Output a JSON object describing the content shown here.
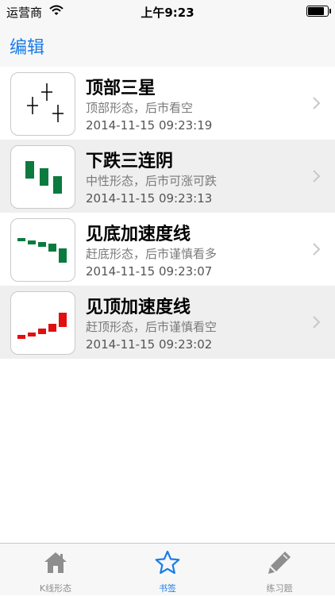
{
  "status_bar": {
    "carrier": "运营商",
    "time": "上午9:23",
    "battery_level": 0.9
  },
  "nav": {
    "edit_label": "编辑",
    "accent": "#1a7ce8"
  },
  "bookmarks": [
    {
      "title": "顶部三星",
      "subtitle": "顶部形态，后市看空",
      "date": "2014-11-15 09:23:19",
      "icon": "top-three-stars-pattern-icon"
    },
    {
      "title": "下跌三连阴",
      "subtitle": "中性形态，后市可涨可跌",
      "date": "2014-11-15 09:23:13",
      "icon": "three-falling-bearish-candles-icon"
    },
    {
      "title": "见底加速度线",
      "subtitle": "赶底形态，后市谨慎看多",
      "date": "2014-11-15 09:23:07",
      "icon": "bottom-acceleration-line-icon"
    },
    {
      "title": "见顶加速度线",
      "subtitle": "赶顶形态，后市谨慎看空",
      "date": "2014-11-15 09:23:02",
      "icon": "top-acceleration-line-icon"
    }
  ],
  "colors": {
    "bear_green": "#0a7a3e",
    "bull_red": "#e01010",
    "tab_inactive": "#8e8e8e"
  },
  "tabs": [
    {
      "label": "K线形态",
      "icon": "home-icon",
      "active": false
    },
    {
      "label": "书签",
      "icon": "star-icon",
      "active": true
    },
    {
      "label": "练习题",
      "icon": "pencil-icon",
      "active": false
    }
  ]
}
